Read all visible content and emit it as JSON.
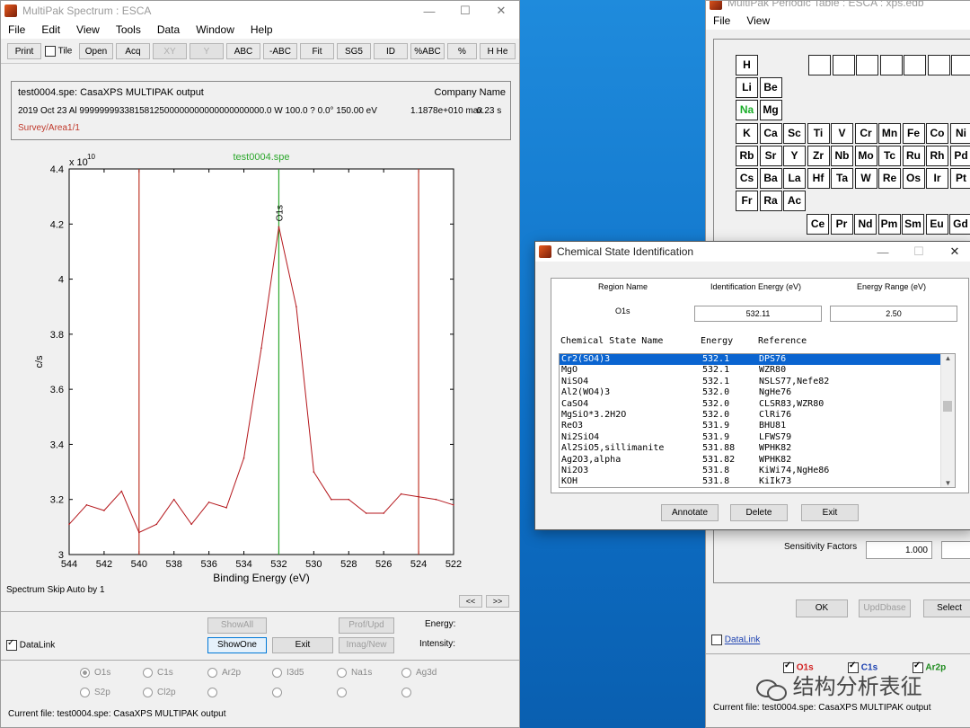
{
  "colors": {
    "accent": "#0a64d0",
    "red_line": "#c0392b",
    "green_line": "#2ea82e",
    "spectrum": "#b4161b"
  },
  "main_window": {
    "title": "MultiPak Spectrum : ESCA",
    "menus": [
      "File",
      "Edit",
      "View",
      "Tools",
      "Data",
      "Window",
      "Help"
    ],
    "toolbar": [
      "Print",
      "Tile",
      "Open",
      "Acq",
      "XY",
      "Y",
      "ABC",
      "-ABC",
      "Fit",
      "SG5",
      "ID",
      "%ABC",
      "%",
      "H He"
    ],
    "info": {
      "line1": "test0004.spe: CasaXPS MULTIPAK output",
      "company": "Company Name",
      "line2": "2019 Oct 23  Al   9999999933815812500000000000000000000.0 W   100.0 ?  0.0°   150.00 eV",
      "line2b": "1.1878e+010 max",
      "line2c": "0.23 s",
      "line3": "Survey/Area1/1"
    },
    "skip_text": "Spectrum Skip Auto by 1",
    "nav_prev": "<<",
    "nav_next": ">>",
    "buttons": {
      "show_all": "ShowAll",
      "prof_upd": "Prof/Upd",
      "show_one": "ShowOne",
      "exit": "Exit",
      "imag_new": "Imag/New"
    },
    "datalink": "DataLink",
    "energy_label": "Energy:",
    "intensity_label": "Intensity:",
    "regions_row1": [
      "O1s",
      "C1s",
      "Ar2p",
      "I3d5",
      "Na1s",
      "Ag3d"
    ],
    "regions_row2": [
      "S2p",
      "Cl2p",
      "",
      "",
      "",
      ""
    ],
    "status": "Current file: test0004.spe: CasaXPS MULTIPAK output"
  },
  "chart_data": {
    "type": "line",
    "title": "test0004.spe",
    "xlabel": "Binding Energy (eV)",
    "ylabel": "c/s",
    "y_multiplier": "x 10",
    "y_multiplier_exp": "10",
    "xlim": [
      544,
      522
    ],
    "ylim": [
      3.0,
      4.4
    ],
    "x_ticks": [
      "544",
      "542",
      "540",
      "538",
      "536",
      "534",
      "532",
      "530",
      "528",
      "526",
      "524",
      "522"
    ],
    "y_ticks": [
      "3",
      "3.2",
      "3.4",
      "3.6",
      "3.8",
      "4",
      "4.2",
      "4.4"
    ],
    "peak_label": "O1s",
    "markers": {
      "red": [
        540,
        524
      ],
      "green": 532
    },
    "series": [
      {
        "x": [
          544,
          543,
          542,
          541,
          540,
          539,
          538,
          537,
          536,
          535,
          534,
          533,
          532,
          531,
          530,
          529,
          528,
          527,
          526,
          525,
          524,
          523,
          522
        ],
        "y": [
          3.11,
          3.18,
          3.16,
          3.23,
          3.08,
          3.11,
          3.2,
          3.11,
          3.19,
          3.17,
          3.35,
          3.75,
          4.19,
          3.9,
          3.3,
          3.2,
          3.2,
          3.15,
          3.15,
          3.22,
          3.21,
          3.2,
          3.18
        ]
      }
    ]
  },
  "periodic_window": {
    "title": "MultiPak Periodic Table : ESCA : xps.edb",
    "menus": [
      "File",
      "View"
    ],
    "elements": [
      [
        "H"
      ],
      [
        "Li",
        "Be"
      ],
      [
        "Na",
        "Mg"
      ],
      [
        "K",
        "Ca",
        "Sc",
        "Ti",
        "V",
        "Cr",
        "Mn",
        "Fe",
        "Co",
        "Ni"
      ],
      [
        "Rb",
        "Sr",
        "Y",
        "Zr",
        "Nb",
        "Mo",
        "Tc",
        "Ru",
        "Rh",
        "Pd"
      ],
      [
        "Cs",
        "Ba",
        "La",
        "Hf",
        "Ta",
        "W",
        "Re",
        "Os",
        "Ir",
        "Pt"
      ],
      [
        "Fr",
        "Ra",
        "Ac"
      ],
      [
        "Ce",
        "Pr",
        "Nd",
        "Pm",
        "Sm",
        "Eu",
        "Gd"
      ]
    ],
    "highlight_element": "Na",
    "sensitivity_label": "Sensitivity Factors",
    "sensitivity_value": "1.000",
    "buttons": {
      "ok": "OK",
      "upd_dbase": "UpdDbase",
      "select": "Select"
    },
    "datalink": "DataLink",
    "checks": [
      {
        "label": "O1s",
        "color": "#d22020"
      },
      {
        "label": "C1s",
        "color": "#1a3fb0"
      },
      {
        "label": "Ar2p",
        "color": "#1c8a1c"
      }
    ],
    "status": "Current file: test0004.spe: CasaXPS MULTIPAK output"
  },
  "dialog": {
    "title": "Chemical State Identification",
    "headers": {
      "region": "Region Name",
      "energy": "Identification Energy (eV)",
      "range": "Energy Range (eV)"
    },
    "region_value": "O1s",
    "energy_value": "532.11",
    "range_value": "2.50",
    "list_headers": [
      "Chemical State Name",
      "Energy",
      "Reference"
    ],
    "rows": [
      [
        "Cr2(SO4)3",
        "532.1",
        "DPS76"
      ],
      [
        "MgO",
        "532.1",
        "WZR80"
      ],
      [
        "NiSO4",
        "532.1",
        "NSLS77,Nefe82"
      ],
      [
        "Al2(WO4)3",
        "532.0",
        "NgHe76"
      ],
      [
        "CaSO4",
        "532.0",
        "CLSR83,WZR80"
      ],
      [
        "MgSiO*3.2H2O",
        "532.0",
        "ClRi76"
      ],
      [
        "ReO3",
        "531.9",
        "BHU81"
      ],
      [
        "Ni2SiO4",
        "531.9",
        "LFWS79"
      ],
      [
        "Al2SiO5,sillimanite",
        "531.88",
        "WPHK82"
      ],
      [
        "Ag2O3,alpha",
        "531.82",
        "WPHK82"
      ],
      [
        "Ni2O3",
        "531.8",
        "KiWi74,NgHe86"
      ],
      [
        "KOH",
        "531.8",
        "KiIk73"
      ]
    ],
    "buttons": {
      "annotate": "Annotate",
      "delete": "Delete",
      "exit": "Exit"
    }
  },
  "watermark": "结构分析表征"
}
